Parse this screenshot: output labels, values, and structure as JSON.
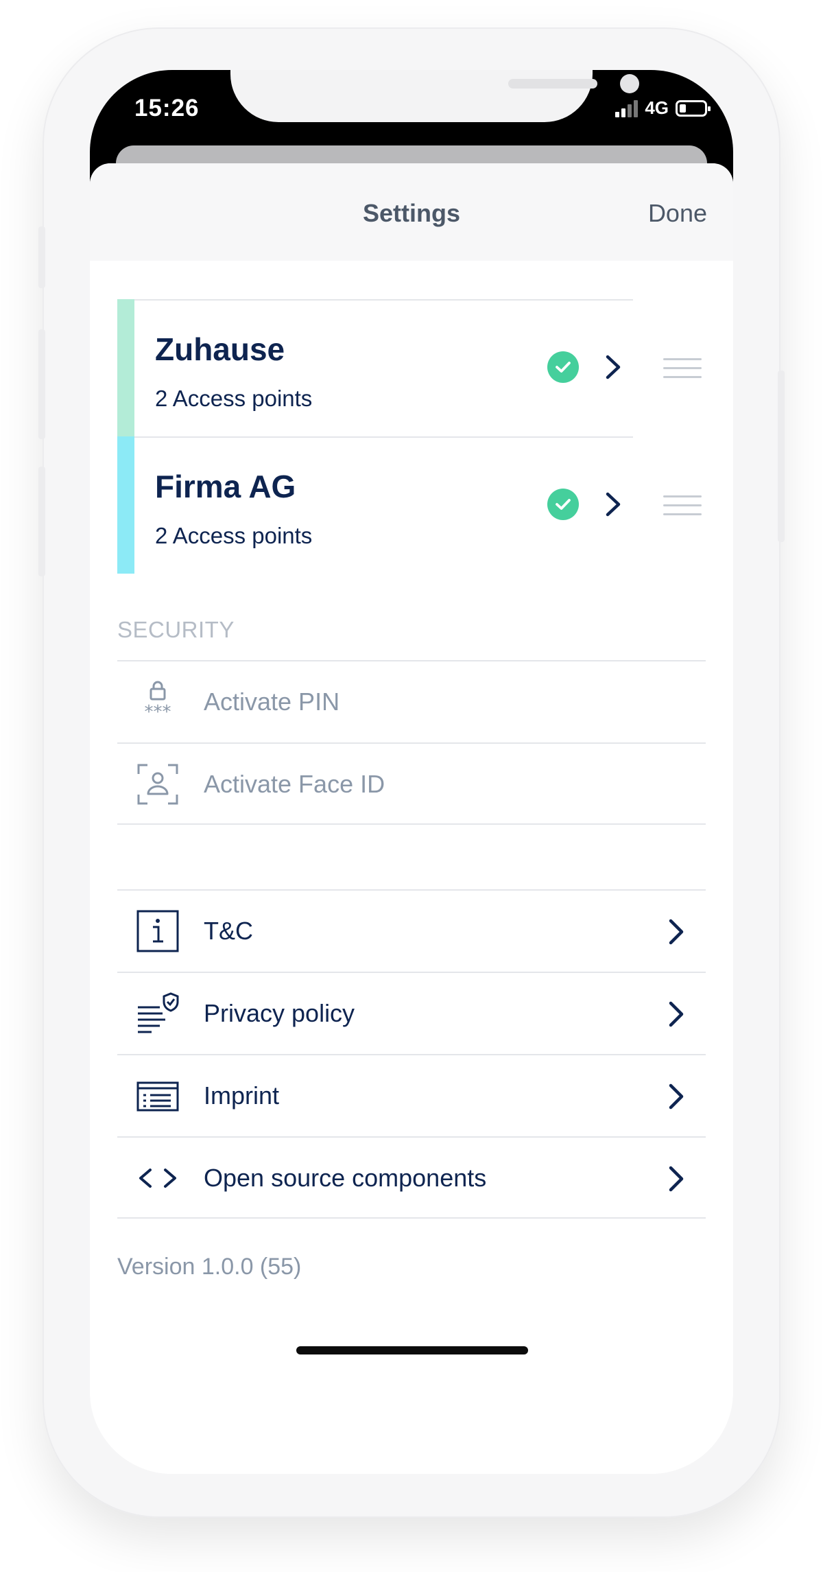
{
  "status_bar": {
    "time": "15:26",
    "network": "4G"
  },
  "navbar": {
    "title": "Settings",
    "done_label": "Done"
  },
  "places": [
    {
      "name": "Zuhause",
      "subtitle": "2 Access points",
      "color": "#b3ecd7"
    },
    {
      "name": "Firma AG",
      "subtitle": "2 Access points",
      "color": "#8ceaf6"
    }
  ],
  "security": {
    "header": "SECURITY",
    "items": [
      {
        "label": "Activate PIN",
        "icon": "lock-pin-icon"
      },
      {
        "label": "Activate Face ID",
        "icon": "face-id-icon"
      }
    ]
  },
  "info": {
    "items": [
      {
        "label": "T&C",
        "icon": "info-icon"
      },
      {
        "label": "Privacy policy",
        "icon": "privacy-shield-icon"
      },
      {
        "label": "Imprint",
        "icon": "imprint-icon"
      },
      {
        "label": "Open source components",
        "icon": "code-icon"
      }
    ]
  },
  "version": "Version 1.0.0 (55)",
  "colors": {
    "primary_text": "#0e2450",
    "muted_text": "#8a97a8",
    "success": "#45cf9c",
    "nav_text": "#4c5868"
  }
}
